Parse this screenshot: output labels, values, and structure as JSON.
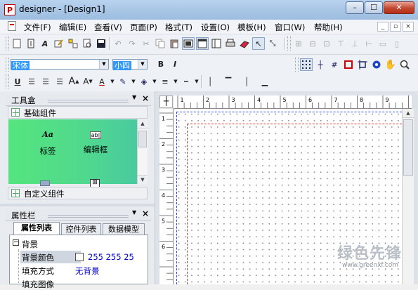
{
  "window": {
    "title": "designer - [Design1]",
    "app_icon_glyph": "P",
    "buttons": {
      "minimize": "–",
      "maximize": "☐",
      "close": "✕"
    }
  },
  "menu": {
    "items": [
      "文件(F)",
      "编辑(E)",
      "查看(V)",
      "页面(P)",
      "格式(T)",
      "设置(O)",
      "模板(H)",
      "窗口(W)",
      "帮助(H)"
    ],
    "mdi_buttons": [
      "_",
      "▫",
      "×"
    ]
  },
  "format_toolbar": {
    "font_name": "宋体",
    "font_size": "小四",
    "bold": "B",
    "italic": "I",
    "underline": "U"
  },
  "toolbox": {
    "title": "工具盒",
    "group_basic": "基础组件",
    "group_custom": "自定义组件",
    "components": [
      {
        "icon_text": "Aa",
        "label": "标签"
      },
      {
        "icon_text": "ab|",
        "label": "编辑框"
      }
    ]
  },
  "properties": {
    "title": "属性栏",
    "tabs": [
      "属性列表",
      "控件列表",
      "数据模型"
    ],
    "category": "背景",
    "rows": [
      {
        "name": "背景颜色",
        "value": "255 255 25"
      },
      {
        "name": "填充方式",
        "value": "无背景"
      },
      {
        "name": "填充图像",
        "value": ""
      }
    ]
  },
  "ruler": {
    "h_ticks": [
      "1",
      "2",
      "3",
      "4",
      "5",
      "6",
      "7",
      "8",
      "9"
    ],
    "v_ticks": [
      "1",
      "2",
      "3",
      "4",
      "5",
      "6"
    ]
  },
  "watermark": {
    "cn": "绿色先锋",
    "url": "www.greenxf.com"
  },
  "colors": {
    "accent": "#3399ff",
    "toolbox_bg": "#50d88e",
    "margin_blue": "#2a4bdc",
    "margin_red": "#e23333"
  }
}
